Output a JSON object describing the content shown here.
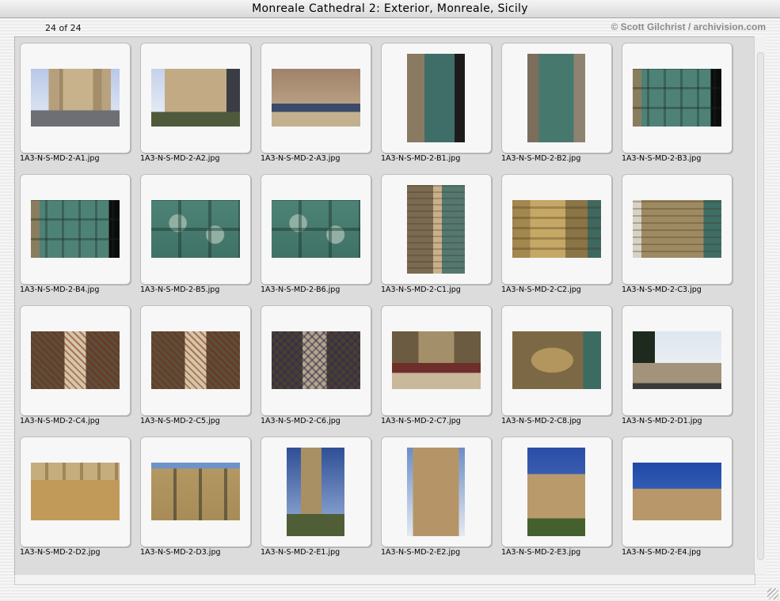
{
  "window": {
    "title": "Monreale Cathedral 2: Exterior, Monreale, Sicily"
  },
  "header": {
    "counter": "24 of 24",
    "copyright": "© Scott Gilchrist / archivision.com"
  },
  "thumbnails": [
    {
      "filename": "1A3-N-S-MD-2-A1.jpg",
      "orientation": "landscape",
      "style": "p-facade"
    },
    {
      "filename": "1A3-N-S-MD-2-A2.jpg",
      "orientation": "landscape",
      "style": "p-facade2"
    },
    {
      "filename": "1A3-N-S-MD-2-A3.jpg",
      "orientation": "landscape",
      "style": "p-arch"
    },
    {
      "filename": "1A3-N-S-MD-2-B1.jpg",
      "orientation": "portrait",
      "style": "p-door"
    },
    {
      "filename": "1A3-N-S-MD-2-B2.jpg",
      "orientation": "portrait",
      "style": "p-door2"
    },
    {
      "filename": "1A3-N-S-MD-2-B3.jpg",
      "orientation": "landscape",
      "style": "p-bronze"
    },
    {
      "filename": "1A3-N-S-MD-2-B4.jpg",
      "orientation": "landscape",
      "style": "p-bronze"
    },
    {
      "filename": "1A3-N-S-MD-2-B5.jpg",
      "orientation": "landscape",
      "style": "p-bronze2"
    },
    {
      "filename": "1A3-N-S-MD-2-B6.jpg",
      "orientation": "landscape",
      "style": "p-bronze2"
    },
    {
      "filename": "1A3-N-S-MD-2-C1.jpg",
      "orientation": "portrait",
      "style": "p-column"
    },
    {
      "filename": "1A3-N-S-MD-2-C2.jpg",
      "orientation": "landscape",
      "style": "p-carve"
    },
    {
      "filename": "1A3-N-S-MD-2-C3.jpg",
      "orientation": "landscape",
      "style": "p-carve2"
    },
    {
      "filename": "1A3-N-S-MD-2-C4.jpg",
      "orientation": "landscape",
      "style": "p-mosaic"
    },
    {
      "filename": "1A3-N-S-MD-2-C5.jpg",
      "orientation": "landscape",
      "style": "p-mosaic"
    },
    {
      "filename": "1A3-N-S-MD-2-C6.jpg",
      "orientation": "landscape",
      "style": "p-mosaic2"
    },
    {
      "filename": "1A3-N-S-MD-2-C7.jpg",
      "orientation": "landscape",
      "style": "p-niche"
    },
    {
      "filename": "1A3-N-S-MD-2-C8.jpg",
      "orientation": "landscape",
      "style": "p-relief"
    },
    {
      "filename": "1A3-N-S-MD-2-D1.jpg",
      "orientation": "landscape",
      "style": "p-piazza"
    },
    {
      "filename": "1A3-N-S-MD-2-D2.jpg",
      "orientation": "landscape",
      "style": "p-wall"
    },
    {
      "filename": "1A3-N-S-MD-2-D3.jpg",
      "orientation": "landscape",
      "style": "p-wall2"
    },
    {
      "filename": "1A3-N-S-MD-2-E1.jpg",
      "orientation": "portrait",
      "style": "p-tower"
    },
    {
      "filename": "1A3-N-S-MD-2-E2.jpg",
      "orientation": "portrait",
      "style": "p-tower2"
    },
    {
      "filename": "1A3-N-S-MD-2-E3.jpg",
      "orientation": "portrait",
      "style": "p-cloister"
    },
    {
      "filename": "1A3-N-S-MD-2-E4.jpg",
      "orientation": "landscape",
      "style": "p-roof"
    }
  ]
}
